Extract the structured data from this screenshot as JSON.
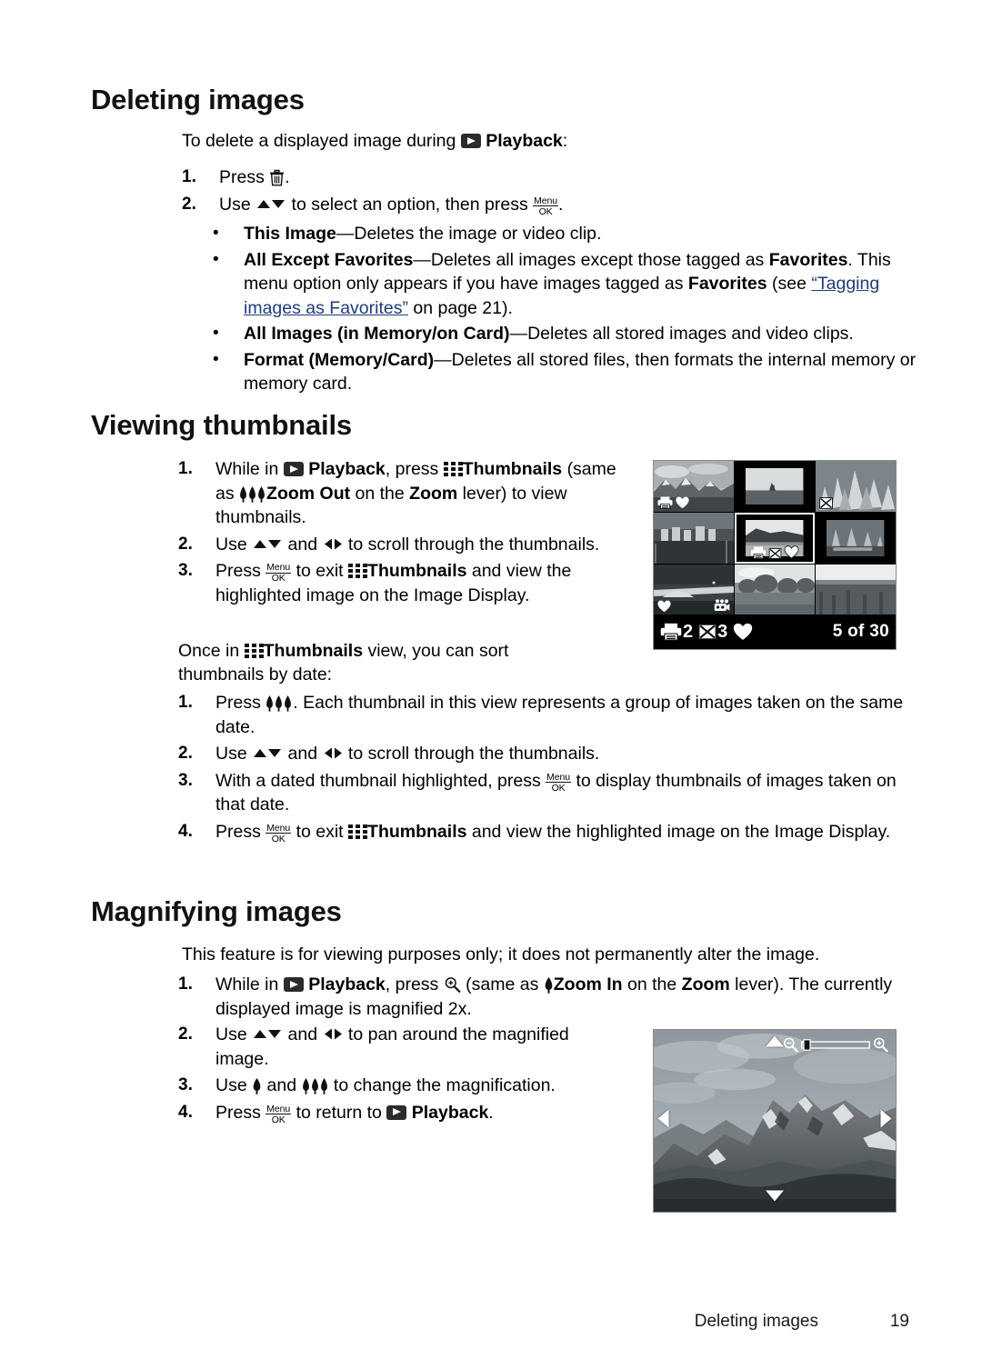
{
  "document": {
    "footer_title": "Deleting images",
    "footer_page": "19"
  },
  "sections": {
    "deleting": {
      "heading": "Deleting images",
      "intro_before": "To delete a displayed image during",
      "intro_bold": "Playback",
      "intro_after": ":",
      "steps": [
        {
          "num": "1.",
          "text_before": "Press",
          "text_after": "."
        },
        {
          "num": "2.",
          "text_before": "Use",
          "text_mid": "to select an option, then press",
          "text_after": "."
        }
      ],
      "options": [
        {
          "bullet": "•",
          "term": "This Image",
          "desc": "—Deletes the image or video clip."
        },
        {
          "bullet": "•",
          "term": "All Except Favorites",
          "desc_a": "—Deletes all images except those tagged as ",
          "term_b": "Favorites",
          "desc_b": ". This menu option only appears if you have images tagged as ",
          "term_c": "Favorites",
          "desc_c": " (see ",
          "link": "“Tagging images as Favorites”",
          "desc_d": " on page 21).",
          "link_page": "21"
        },
        {
          "bullet": "•",
          "term": "All Images (in Memory/on Card)",
          "desc": "—Deletes all stored images and video clips."
        },
        {
          "bullet": "•",
          "term": "Format (Memory/Card)",
          "desc": "—Deletes all stored files, then formats the internal memory or memory card."
        }
      ]
    },
    "thumbnails": {
      "heading": "Viewing thumbnails",
      "steps": [
        {
          "num": "1.",
          "a": "While in",
          "b": "Playback",
          "c": ", press",
          "d": "Thumbnails",
          "e": "(same as",
          "f": "Zoom Out",
          "g": " on the ",
          "h": "Zoom",
          "i": " lever) to view thumbnails."
        },
        {
          "num": "2.",
          "a": "Use",
          "b": "and",
          "c": "to scroll through the thumbnails."
        },
        {
          "num": "3.",
          "a": "Press",
          "b": "to exit",
          "c": "Thumbnails",
          "d": " and view the highlighted image on the Image Display."
        }
      ],
      "once_a": "Once in",
      "once_b": "Thumbnails",
      "once_c": " view, you can sort thumbnails by date:",
      "date_steps": [
        {
          "num": "1.",
          "a": "Press",
          "b": ". Each thumbnail in this view represents a group of images taken on the same date."
        },
        {
          "num": "2.",
          "a": "Use",
          "b": "and",
          "c": "to scroll through the thumbnails."
        },
        {
          "num": "3.",
          "a": "With a dated thumbnail highlighted, press",
          "b": "to display thumbnails of images taken on that date."
        },
        {
          "num": "4.",
          "a": "Press",
          "b": "to exit",
          "c": "Thumbnails",
          "d": " and view the highlighted image on the Image Display."
        }
      ]
    },
    "magnifying": {
      "heading": "Magnifying images",
      "intro": "This feature is for viewing purposes only; it does not permanently alter the image.",
      "steps": [
        {
          "num": "1.",
          "a": "While in",
          "b": "Playback",
          "c": ", press",
          "d": "(same as",
          "e": "Zoom In",
          "f": " on the ",
          "g": "Zoom",
          "h": " lever). The currently displayed image is magnified 2x."
        },
        {
          "num": "2.",
          "a": "Use",
          "b": "and",
          "c": "to pan around the magnified image."
        },
        {
          "num": "3.",
          "a": "Use",
          "b": "and",
          "c": "to change the magnification."
        },
        {
          "num": "4.",
          "a": "Press",
          "b": "to return to",
          "c": "Playback",
          "d": "."
        }
      ]
    }
  },
  "camera_thumbnail_screen": {
    "status": {
      "print_count": "2",
      "share_count": "3",
      "position": "5 of 30"
    },
    "cells": [
      {
        "id": "cell-1",
        "overlays": [
          "print-icon",
          "heart-icon"
        ],
        "selected": false,
        "letterbox": false
      },
      {
        "id": "cell-2",
        "overlays": [],
        "selected": false,
        "letterbox": true
      },
      {
        "id": "cell-3",
        "overlays": [
          "share-icon"
        ],
        "selected": false,
        "letterbox": false
      },
      {
        "id": "cell-4",
        "overlays": [],
        "selected": false,
        "letterbox": false
      },
      {
        "id": "cell-5",
        "overlays": [
          "print-icon",
          "share-icon",
          "heart-icon"
        ],
        "selected": true,
        "letterbox": true
      },
      {
        "id": "cell-6",
        "overlays": [],
        "selected": false,
        "letterbox": true
      },
      {
        "id": "cell-7",
        "overlays": [
          "heart-icon",
          "video-icon"
        ],
        "selected": false,
        "letterbox": false
      },
      {
        "id": "cell-8",
        "overlays": [],
        "selected": false,
        "letterbox": false
      },
      {
        "id": "cell-9",
        "overlays": [],
        "selected": false,
        "letterbox": false
      }
    ]
  },
  "camera_magnify_screen": {
    "pan_arrows": [
      "up-arrow",
      "down-arrow",
      "left-arrow",
      "right-arrow"
    ],
    "zoom_slider": {
      "left_icon": "zoom-out-icon",
      "right_icon": "zoom-in-icon",
      "handle_position_pct": 12
    }
  }
}
